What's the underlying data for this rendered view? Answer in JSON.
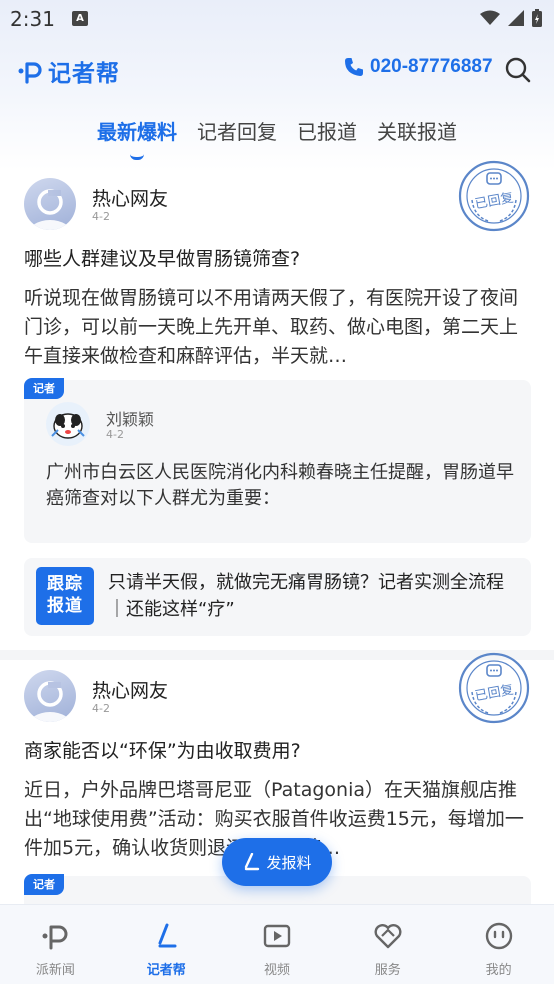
{
  "status_bar": {
    "time": "2:31",
    "notif_letter": "A"
  },
  "header": {
    "logo_text": "记者帮",
    "phone": "020-87776887"
  },
  "tabs": [
    {
      "label": "最新爆料",
      "active": true
    },
    {
      "label": "记者回复",
      "active": false
    },
    {
      "label": "已报道",
      "active": false
    },
    {
      "label": "关联报道",
      "active": false
    }
  ],
  "posts": [
    {
      "user": "热心网友",
      "date": "4-2",
      "stamp": "已回复",
      "question": "哪些人群建议及早做胃肠镜筛查?",
      "content": "听说现在做胃肠镜可以不用请两天假了，有医院开设了夜间门诊，可以前一天晚上先开单、取药、做心电图，第二天上午直接来做检查和麻醉评估，半天就…",
      "reply": {
        "tag": "记者",
        "reporter": "刘颖颖",
        "date": "4-2",
        "text": "广州市白云区人民医院消化内科赖春晓主任提醒，胃肠道早癌筛查对以下人群尤为重要："
      },
      "follow": {
        "badge_line1": "跟踪",
        "badge_line2": "报道",
        "title": "只请半天假，就做完无痛胃肠镜？记者实测全流程｜还能这样“疗”"
      }
    },
    {
      "user": "热心网友",
      "date": "4-2",
      "stamp": "已回复",
      "question": "商家能否以“环保”为由收取费用?",
      "content": "近日，户外品牌巴塔哥尼亚（Patagonia）在天猫旗舰店推出“地球使用费”活动：购买衣服首件收运费15元，每增加一件加5元，确认收货则退还运费，若…",
      "reply": {
        "tag": "记者"
      }
    }
  ],
  "fab": {
    "label": "发报料"
  },
  "bottom_nav": [
    {
      "label": "派新闻",
      "icon": "pai-logo-icon",
      "active": false
    },
    {
      "label": "记者帮",
      "icon": "reporter-pen-icon",
      "active": true
    },
    {
      "label": "视频",
      "icon": "video-play-icon",
      "active": false
    },
    {
      "label": "服务",
      "icon": "heart-service-icon",
      "active": false
    },
    {
      "label": "我的",
      "icon": "smiley-profile-icon",
      "active": false
    }
  ],
  "colors": {
    "accent": "#1e6fe8",
    "stamp": "#5b86c9"
  }
}
